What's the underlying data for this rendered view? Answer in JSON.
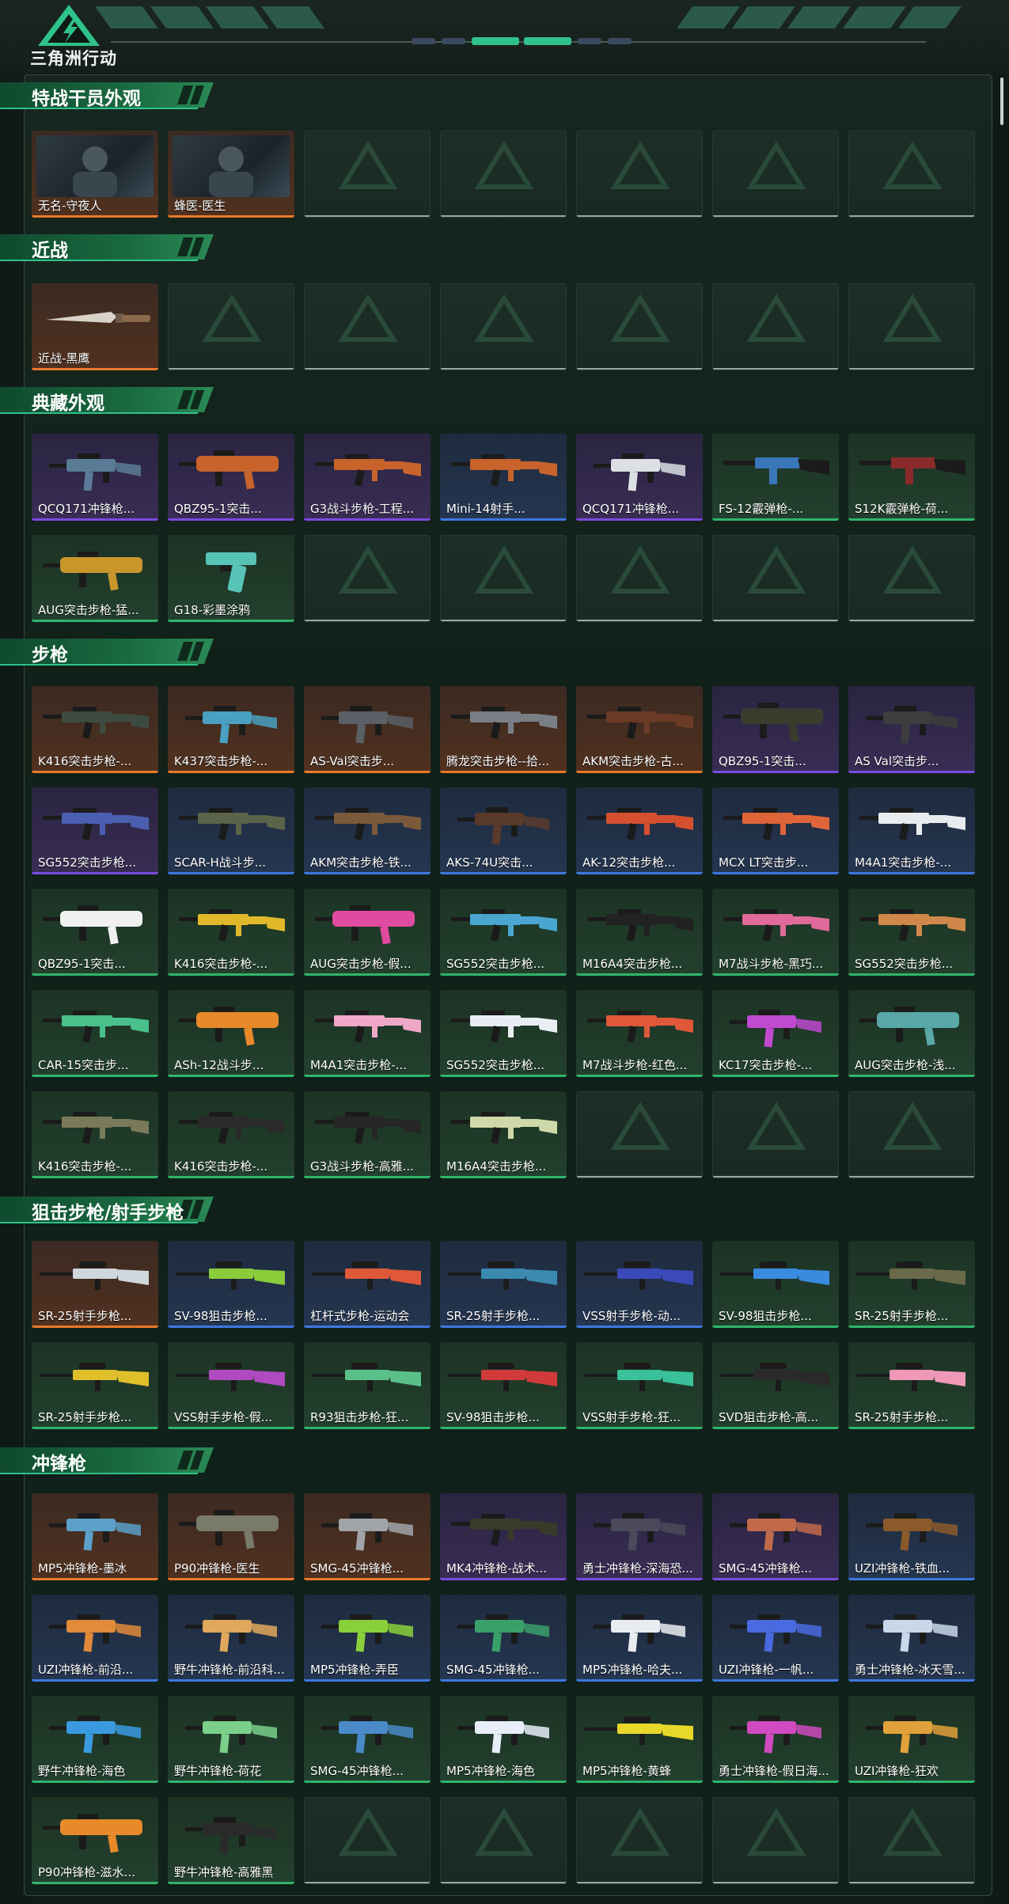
{
  "app": {
    "title": "三角洲行动"
  },
  "colors": {
    "orange": "#e8792a",
    "purple": "#7a4be0",
    "blue": "#3e77e0",
    "green": "#2fb56a",
    "accent": "#2fc28a"
  },
  "sections": [
    {
      "title": "特战干员外观",
      "items": [
        {
          "name": "无名-守夜人",
          "rarity": "orange",
          "kind": "operator"
        },
        {
          "name": "蜂医-医生",
          "rarity": "orange",
          "kind": "operator"
        }
      ]
    },
    {
      "title": "近战",
      "items": [
        {
          "name": "近战-黑鹰",
          "rarity": "orange",
          "kind": "knife"
        }
      ]
    },
    {
      "title": "典藏外观",
      "items": [
        {
          "name": "QCQ171冲锋枪...",
          "rarity": "purple",
          "kind": "smg",
          "color": "#5a7b95"
        },
        {
          "name": "QBZ95-1突击...",
          "rarity": "purple",
          "kind": "bullpup",
          "color": "#c8632c"
        },
        {
          "name": "G3战斗步枪-工程...",
          "rarity": "purple",
          "kind": "rifle",
          "color": "#c8632c"
        },
        {
          "name": "Mini-14射手...",
          "rarity": "blue",
          "kind": "rifle",
          "color": "#c8632c"
        },
        {
          "name": "QCQ171冲锋枪...",
          "rarity": "purple",
          "kind": "smg",
          "color": "#dcdfe4"
        },
        {
          "name": "FS-12霰弹枪-...",
          "rarity": "green",
          "kind": "shotgun",
          "color": "#3a77b8"
        },
        {
          "name": "S12K霰弹枪-荷...",
          "rarity": "green",
          "kind": "shotgun",
          "color": "#8a2a2a"
        },
        {
          "name": "AUG突击步枪-猛...",
          "rarity": "green",
          "kind": "bullpup",
          "color": "#c9962c"
        },
        {
          "name": "G18-彩墨涂鸦",
          "rarity": "green",
          "kind": "pistol",
          "color": "#58c4b8"
        }
      ]
    },
    {
      "title": "步枪",
      "items": [
        {
          "name": "K416突击步枪-...",
          "rarity": "orange",
          "kind": "rifle",
          "color": "#3d4a3f"
        },
        {
          "name": "K437突击步枪-...",
          "rarity": "orange",
          "kind": "smg",
          "color": "#4aa0c0"
        },
        {
          "name": "AS-Val突击步...",
          "rarity": "orange",
          "kind": "smg",
          "color": "#5b6066"
        },
        {
          "name": "腾龙突击步枪--拾...",
          "rarity": "orange",
          "kind": "rifle",
          "color": "#7a7f86"
        },
        {
          "name": "AKM突击步枪-古...",
          "rarity": "orange",
          "kind": "rifle",
          "color": "#6b3a26"
        },
        {
          "name": "QBZ95-1突击...",
          "rarity": "purple",
          "kind": "bullpup",
          "color": "#3a3d2e"
        },
        {
          "name": "AS Val突击步...",
          "rarity": "purple",
          "kind": "smg",
          "color": "#3d3d3d"
        },
        {
          "name": "SG552突击步枪...",
          "rarity": "purple",
          "kind": "rifle",
          "color": "#4a5fb0"
        },
        {
          "name": "SCAR-H战斗步...",
          "rarity": "blue",
          "kind": "rifle",
          "color": "#5a6448"
        },
        {
          "name": "AKM突击步枪-铁...",
          "rarity": "blue",
          "kind": "rifle",
          "color": "#7a5a3a"
        },
        {
          "name": "AKS-74U突击...",
          "rarity": "blue",
          "kind": "smg",
          "color": "#5a3a2a"
        },
        {
          "name": "AK-12突击步枪...",
          "rarity": "blue",
          "kind": "rifle",
          "color": "#d4502f"
        },
        {
          "name": "MCX LT突击步...",
          "rarity": "blue",
          "kind": "rifle",
          "color": "#e0643a"
        },
        {
          "name": "M4A1突击步枪-...",
          "rarity": "blue",
          "kind": "rifle",
          "color": "#e8ecef"
        },
        {
          "name": "QBZ95-1突击...",
          "rarity": "green",
          "kind": "bullpup",
          "color": "#f0f0f0"
        },
        {
          "name": "K416突击步枪-...",
          "rarity": "green",
          "kind": "rifle",
          "color": "#e0b82a"
        },
        {
          "name": "AUG突击步枪-假...",
          "rarity": "green",
          "kind": "bullpup",
          "color": "#e04aa0"
        },
        {
          "name": "SG552突击步枪...",
          "rarity": "green",
          "kind": "rifle",
          "color": "#4aa6d0"
        },
        {
          "name": "M16A4突击步枪...",
          "rarity": "green",
          "kind": "rifle",
          "color": "#222222"
        },
        {
          "name": "M7战斗步枪-黑巧...",
          "rarity": "green",
          "kind": "rifle",
          "color": "#e06a9a"
        },
        {
          "name": "SG552突击步枪...",
          "rarity": "green",
          "kind": "rifle",
          "color": "#d0884a"
        },
        {
          "name": "CAR-15突击步...",
          "rarity": "green",
          "kind": "rifle",
          "color": "#4ac08a"
        },
        {
          "name": "ASh-12战斗步...",
          "rarity": "green",
          "kind": "bullpup",
          "color": "#e88a2a"
        },
        {
          "name": "M4A1突击步枪-...",
          "rarity": "green",
          "kind": "rifle",
          "color": "#f0a8c8"
        },
        {
          "name": "SG552突击步枪...",
          "rarity": "green",
          "kind": "rifle",
          "color": "#e8eef4"
        },
        {
          "name": "M7战斗步枪-红色...",
          "rarity": "green",
          "kind": "rifle",
          "color": "#e0583a"
        },
        {
          "name": "KC17突击步枪-...",
          "rarity": "green",
          "kind": "smg",
          "color": "#c04ad0"
        },
        {
          "name": "AUG突击步枪-浅...",
          "rarity": "green",
          "kind": "bullpup",
          "color": "#5aa8a8"
        },
        {
          "name": "K416突击步枪-...",
          "rarity": "green",
          "kind": "rifle",
          "color": "#7a7a5a"
        },
        {
          "name": "K416突击步枪-...",
          "rarity": "green",
          "kind": "rifle",
          "color": "#2a2a2a"
        },
        {
          "name": "G3战斗步枪-高雅...",
          "rarity": "green",
          "kind": "rifle",
          "color": "#262626"
        },
        {
          "name": "M16A4突击步枪...",
          "rarity": "green",
          "kind": "rifle",
          "color": "#cfd8a8"
        }
      ]
    },
    {
      "title": "狙击步枪/射手步枪",
      "items": [
        {
          "name": "SR-25射手步枪...",
          "rarity": "orange",
          "kind": "sniper",
          "color": "#cfd8dc"
        },
        {
          "name": "SV-98狙击步枪...",
          "rarity": "blue",
          "kind": "sniper",
          "color": "#8acc3a"
        },
        {
          "name": "杠杆式步枪-运动会",
          "rarity": "blue",
          "kind": "sniper",
          "color": "#e0583a"
        },
        {
          "name": "SR-25射手步枪...",
          "rarity": "blue",
          "kind": "sniper",
          "color": "#3a8ab0"
        },
        {
          "name": "VSS射手步枪-动...",
          "rarity": "blue",
          "kind": "sniper",
          "color": "#3a4ab8"
        },
        {
          "name": "SV-98狙击步枪...",
          "rarity": "green",
          "kind": "sniper",
          "color": "#3a8ae0"
        },
        {
          "name": "SR-25射手步枪...",
          "rarity": "green",
          "kind": "sniper",
          "color": "#6a6a4a"
        },
        {
          "name": "SR-25射手步枪...",
          "rarity": "green",
          "kind": "sniper",
          "color": "#e0c02a"
        },
        {
          "name": "VSS射手步枪-假...",
          "rarity": "green",
          "kind": "sniper",
          "color": "#b04ac0"
        },
        {
          "name": "R93狙击步枪-狂...",
          "rarity": "green",
          "kind": "sniper",
          "color": "#5ac08a"
        },
        {
          "name": "SV-98狙击步枪...",
          "rarity": "green",
          "kind": "sniper",
          "color": "#d03a3a"
        },
        {
          "name": "VSS射手步枪-狂...",
          "rarity": "green",
          "kind": "sniper",
          "color": "#3ac09a"
        },
        {
          "name": "SVD狙击步枪-高...",
          "rarity": "green",
          "kind": "sniper",
          "color": "#2a2a2a"
        },
        {
          "name": "SR-25射手步枪...",
          "rarity": "green",
          "kind": "sniper",
          "color": "#f098b8"
        }
      ]
    },
    {
      "title": "冲锋枪",
      "items": [
        {
          "name": "MP5冲锋枪-墨冰",
          "rarity": "orange",
          "kind": "smg",
          "color": "#5aa0c8"
        },
        {
          "name": "P90冲锋枪-医生",
          "rarity": "orange",
          "kind": "bullpup",
          "color": "#7a7a6a"
        },
        {
          "name": "SMG-45冲锋枪...",
          "rarity": "orange",
          "kind": "smg",
          "color": "#a0a4a8"
        },
        {
          "name": "MK4冲锋枪-战术...",
          "rarity": "purple",
          "kind": "rifle",
          "color": "#3a3a2a"
        },
        {
          "name": "勇士冲锋枪-深海恐...",
          "rarity": "purple",
          "kind": "smg",
          "color": "#4a4a5a"
        },
        {
          "name": "SMG-45冲锋枪...",
          "rarity": "purple",
          "kind": "smg",
          "color": "#c06a4a"
        },
        {
          "name": "UZI冲锋枪-铁血...",
          "rarity": "blue",
          "kind": "smg",
          "color": "#8a5a2a"
        },
        {
          "name": "UZI冲锋枪-前沿...",
          "rarity": "blue",
          "kind": "smg",
          "color": "#e08a3a"
        },
        {
          "name": "野牛冲锋枪-前沿科...",
          "rarity": "blue",
          "kind": "smg",
          "color": "#e0a85a"
        },
        {
          "name": "MP5冲锋枪-弄臣",
          "rarity": "blue",
          "kind": "smg",
          "color": "#8ad03a"
        },
        {
          "name": "SMG-45冲锋枪...",
          "rarity": "blue",
          "kind": "smg",
          "color": "#3aa06a"
        },
        {
          "name": "MP5冲锋枪-哈夫...",
          "rarity": "blue",
          "kind": "smg",
          "color": "#e8ecf0"
        },
        {
          "name": "UZI冲锋枪-一帆...",
          "rarity": "blue",
          "kind": "smg",
          "color": "#4a6ae0"
        },
        {
          "name": "勇士冲锋枪-冰天雪...",
          "rarity": "blue",
          "kind": "smg",
          "color": "#c8d8e8"
        },
        {
          "name": "野牛冲锋枪-海色",
          "rarity": "green",
          "kind": "smg",
          "color": "#3a9ae0"
        },
        {
          "name": "野牛冲锋枪-荷花",
          "rarity": "green",
          "kind": "smg",
          "color": "#7ad08a"
        },
        {
          "name": "SMG-45冲锋枪...",
          "rarity": "green",
          "kind": "smg",
          "color": "#4a8ac8"
        },
        {
          "name": "MP5冲锋枪-海色",
          "rarity": "green",
          "kind": "smg",
          "color": "#e8eef8"
        },
        {
          "name": "MP5冲锋枪-黄蜂",
          "rarity": "green",
          "kind": "sniper",
          "color": "#e8d82a"
        },
        {
          "name": "勇士冲锋枪-假日海...",
          "rarity": "green",
          "kind": "smg",
          "color": "#d04ac0"
        },
        {
          "name": "UZI冲锋枪-狂欢",
          "rarity": "green",
          "kind": "smg",
          "color": "#e0a03a"
        },
        {
          "name": "P90冲锋枪-滋水...",
          "rarity": "green",
          "kind": "bullpup",
          "color": "#e88a2a"
        },
        {
          "name": "野牛冲锋枪-高雅黑",
          "rarity": "green",
          "kind": "smg",
          "color": "#2a2a2a"
        }
      ]
    }
  ]
}
